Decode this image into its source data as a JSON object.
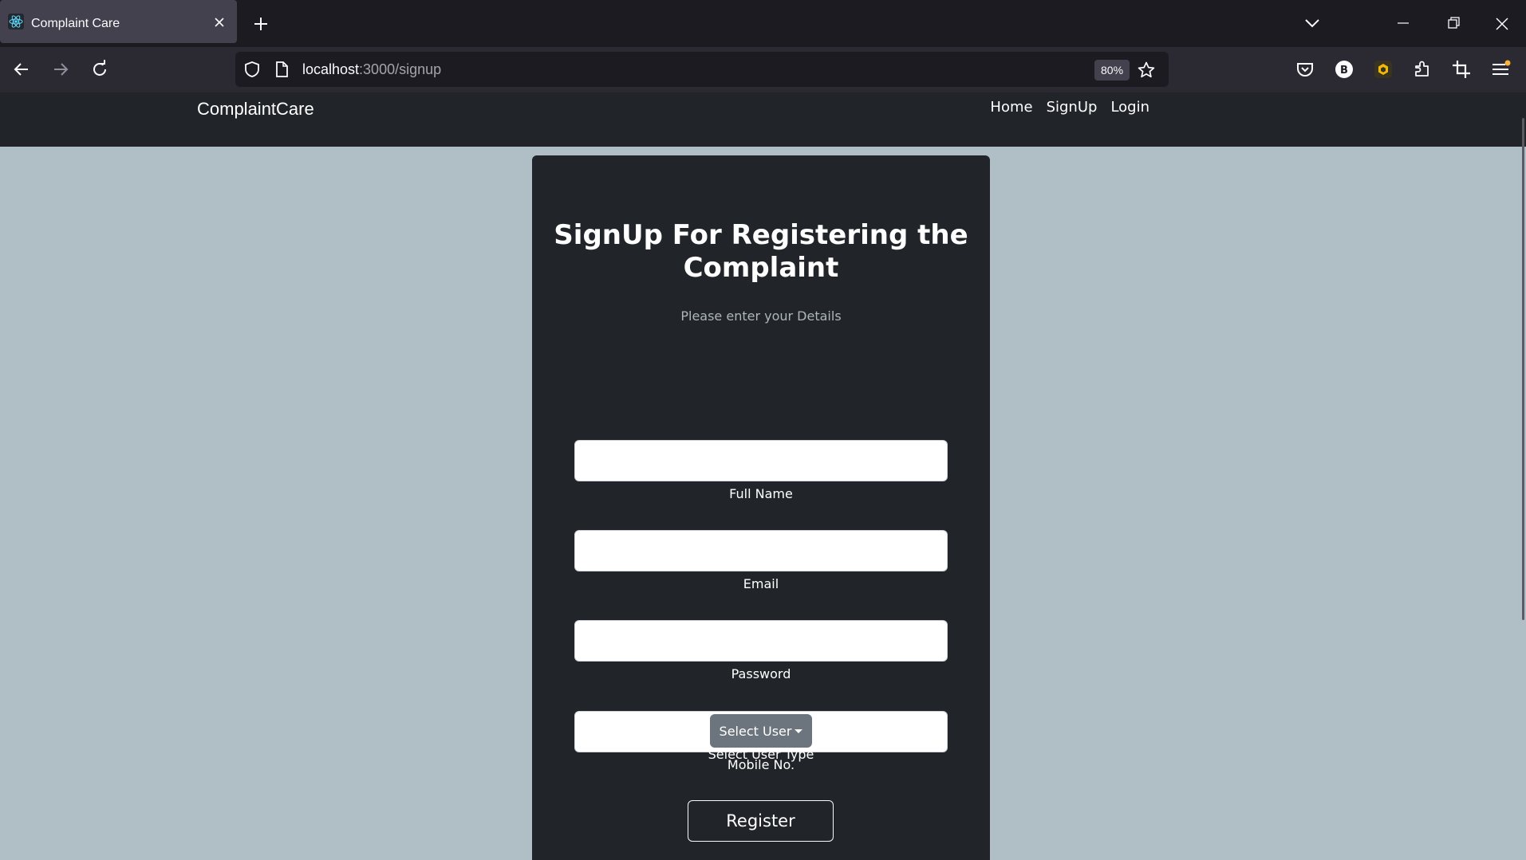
{
  "browser": {
    "tab_title": "Complaint Care",
    "url_host": "localhost",
    "url_path": ":3000/signup",
    "zoom": "80%",
    "profile_initial": "B"
  },
  "app": {
    "brand": "ComplaintCare",
    "nav": {
      "home": "Home",
      "signup": "SignUp",
      "login": "Login"
    }
  },
  "form": {
    "title": "SignUp For Registering the Complaint",
    "subtitle": "Please enter your Details",
    "fields": [
      {
        "label": "Full Name",
        "value": ""
      },
      {
        "label": "Email",
        "value": ""
      },
      {
        "label": "Password",
        "value": ""
      },
      {
        "label": "Mobile No.",
        "value": ""
      }
    ],
    "user_type": {
      "button": "Select User",
      "label": "Select User Type"
    },
    "submit": "Register"
  }
}
